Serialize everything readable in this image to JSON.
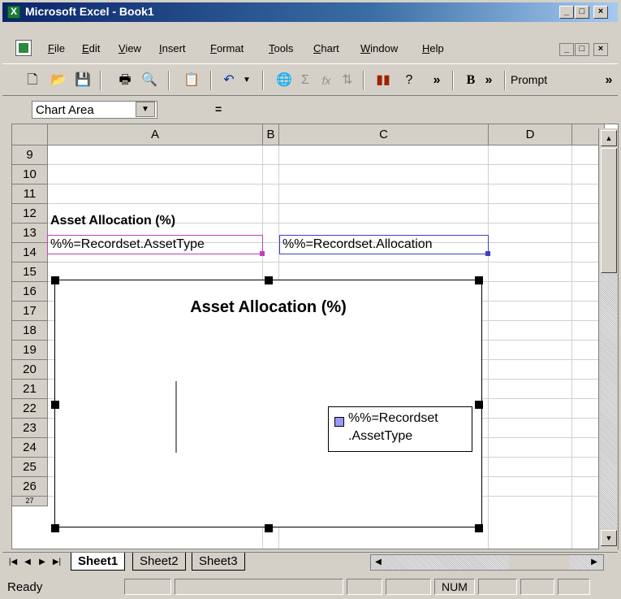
{
  "window": {
    "title": "Microsoft Excel - Book1",
    "min_label": "_",
    "max_label": "□",
    "close_label": "×"
  },
  "menubar": {
    "items": [
      "File",
      "Edit",
      "View",
      "Insert",
      "Format",
      "Tools",
      "Chart",
      "Window",
      "Help"
    ]
  },
  "toolbar": {
    "icons": [
      "new-icon",
      "open-icon",
      "save-icon",
      "print-icon",
      "print-preview-icon",
      "paste-icon",
      "undo-icon",
      "hyperlink-icon",
      "autosum-icon",
      "function-icon",
      "sort-icon",
      "chart-wizard-icon",
      "help-icon",
      "bold-icon"
    ],
    "more_label": "»",
    "prompt_label": "Prompt"
  },
  "formula_bar": {
    "name_box": "Chart Area",
    "equals": "=",
    "value": ""
  },
  "columns": [
    "A",
    "B",
    "C",
    "D"
  ],
  "rows": [
    "9",
    "10",
    "11",
    "12",
    "13",
    "14",
    "15",
    "16",
    "17",
    "18",
    "19",
    "20",
    "21",
    "22",
    "23",
    "24",
    "25",
    "26",
    "27"
  ],
  "cells": {
    "a12": "Asset Allocation (%)",
    "a13": "%%=Recordset.AssetType",
    "c13": "%%=Recordset.Allocation"
  },
  "chart": {
    "title": "Asset Allocation (%)",
    "legend_line1": "%%=Recordset",
    "legend_line2": ".AssetType"
  },
  "sheets": {
    "tabs": [
      "Sheet1",
      "Sheet2",
      "Sheet3"
    ],
    "active": "Sheet1"
  },
  "status": {
    "text": "Ready",
    "num": "NUM"
  },
  "colors": {
    "title_bar": "#0a246a",
    "legend_swatch": "#9999ff",
    "field_box_a13": "#c040c0",
    "field_box_c13": "#4040c0"
  }
}
